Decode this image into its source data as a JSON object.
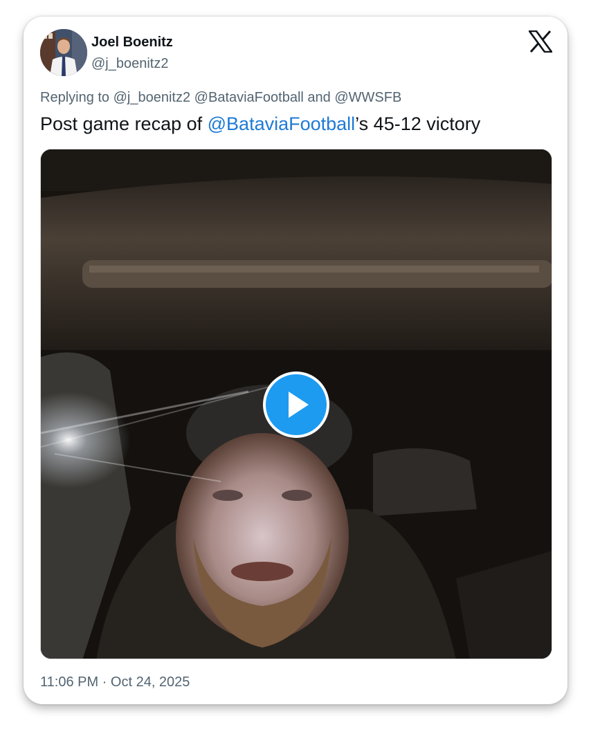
{
  "tweet": {
    "display_name": "Joel Boenitz",
    "handle": "@j_boenitz2",
    "reply": {
      "prefix": "Replying to ",
      "mention_1": "@j_boenitz2",
      "sep_1": " ",
      "mention_2": "@BataviaFootball",
      "sep_2": " and ",
      "mention_3": "@WWSFB"
    },
    "text": {
      "part_1": "Post game recap of ",
      "mention": "@BataviaFootball",
      "part_2": "’s 45-12 victory"
    },
    "timestamp": {
      "time": "11:06 PM",
      "separator": " · ",
      "date": "Oct 24, 2025"
    }
  },
  "icons": {
    "brand": "x-logo-icon",
    "play": "play-icon",
    "avatar": "profile-photo"
  },
  "colors": {
    "accent": "#1d9bf0",
    "mention": "#1d7ad6",
    "text_primary": "#0f1419",
    "text_secondary": "#536471"
  }
}
